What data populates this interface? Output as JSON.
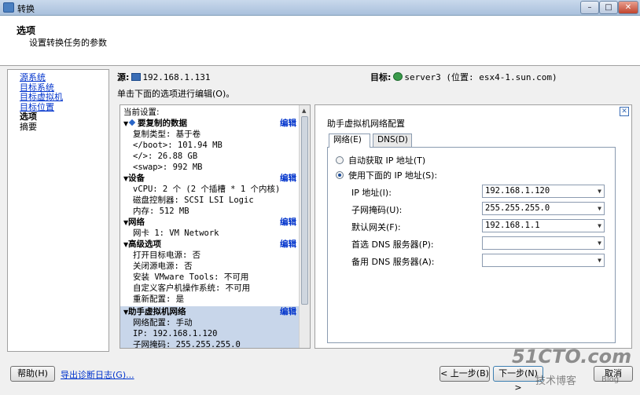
{
  "window": {
    "title": "转换"
  },
  "header": {
    "title": "选项",
    "subtitle": "设置转换任务的参数"
  },
  "nav": {
    "items": [
      {
        "label": "源系统",
        "state": "link"
      },
      {
        "label": "目标系统",
        "state": "link"
      },
      {
        "label": "目标虚拟机",
        "state": "link"
      },
      {
        "label": "目标位置",
        "state": "link"
      },
      {
        "label": "选项",
        "state": "current"
      },
      {
        "label": "摘要",
        "state": "plain"
      }
    ]
  },
  "source": {
    "label": "源:",
    "value": "192.168.1.131"
  },
  "target": {
    "label": "目标:",
    "value": "server3 (位置: esx4-1.sun.com)"
  },
  "edit_hint": "单击下面的选项进行编辑(O)。",
  "settings": {
    "header": "当前设置:",
    "edit_label": "编辑",
    "sections": [
      {
        "title": "要复制的数据",
        "lines": [
          "复制类型: 基于卷",
          "</boot>: 101.94 MB",
          "</>: 26.88 GB",
          "<swap>: 992 MB"
        ]
      },
      {
        "title": "设备",
        "lines": [
          "vCPU: 2 个 (2 个插槽 * 1 个内核)",
          "磁盘控制器: SCSI LSI Logic",
          "内存: 512 MB"
        ]
      },
      {
        "title": "网络",
        "lines": [
          "网卡 1: VM Network"
        ]
      },
      {
        "title": "高级选项",
        "lines": [
          "打开目标电源: 否",
          "关闭源电源: 否",
          "安装 VMware Tools: 不可用",
          "自定义客户机操作系统: 不可用",
          "重新配置: 是"
        ]
      },
      {
        "title": "助手虚拟机网络",
        "lines": [
          "网络配置: 手动",
          "IP: 192.168.1.120",
          "子网掩码: 255.255.255.0"
        ]
      }
    ]
  },
  "detail": {
    "title": "助手虚拟机网络配置",
    "tabs": [
      {
        "label": "网络(E)"
      },
      {
        "label": "DNS(D)"
      }
    ],
    "radio_auto": "自动获取 IP 地址(T)",
    "radio_manual": "使用下面的 IP 地址(S):",
    "fields": [
      {
        "label": "IP 地址(I):",
        "value": "192.168.1.120"
      },
      {
        "label": "子网掩码(U):",
        "value": "255.255.255.0"
      },
      {
        "label": "默认网关(F):",
        "value": "192.168.1.1"
      },
      {
        "label": "首选 DNS 服务器(P):",
        "value": ""
      },
      {
        "label": "备用 DNS 服务器(A):",
        "value": ""
      }
    ]
  },
  "footer": {
    "help": "帮助(H)",
    "export": "导出诊断日志(G)...",
    "back": "< 上一步(B)",
    "next": "下一步(N) >",
    "cancel": "取消"
  },
  "watermark": {
    "main": "51CTO.com",
    "sub": "技术博客",
    "blog": "Blog"
  }
}
